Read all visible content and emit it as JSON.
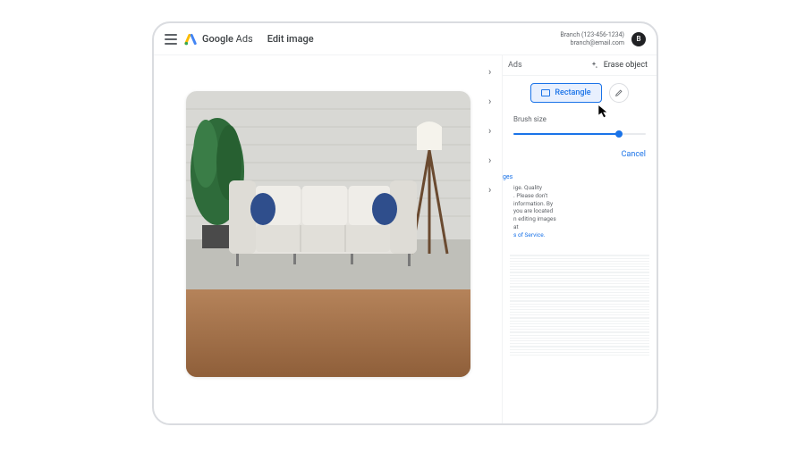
{
  "header": {
    "brand_bold": "Google",
    "brand_regular": "Ads",
    "page_title": "Edit image",
    "account_line1": "Branch (123-456-1234)",
    "account_line2": "branch@email.com",
    "avatar_initial": "B"
  },
  "panel": {
    "back_label": "Ads",
    "title": "Erase object",
    "tool_rectangle_label": "Rectangle",
    "brush_size_label": "Brush size",
    "brush_size_value": 80,
    "cancel_label": "Cancel",
    "link_label": "ges",
    "disclaimer_lines": [
      "ige. Quality",
      ". Please don't",
      "information. By",
      "you are located",
      "n editing images",
      "at"
    ],
    "tos_label": "s of Service."
  },
  "icons": {
    "menu": "menu-icon",
    "logo": "google-ads-logo-icon",
    "sparkle": "sparkle-icon",
    "rectangle": "rectangle-icon",
    "brush": "brush-icon",
    "cursor": "cursor-icon",
    "chevron": "chevron-right-icon"
  },
  "colors": {
    "primary": "#1a73e8",
    "primary_bg": "#e8f0fe",
    "text": "#3c4043",
    "muted": "#5f6368",
    "border": "#dadce0"
  }
}
